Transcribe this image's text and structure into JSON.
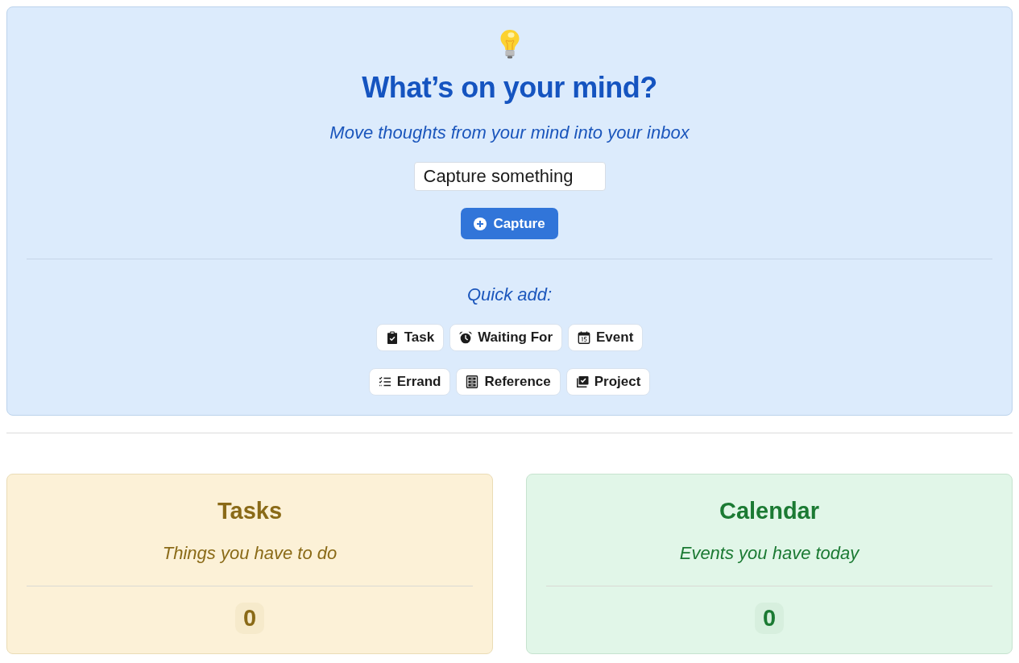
{
  "capture": {
    "title": "What’s on your mind?",
    "subtitle": "Move thoughts from your mind into your inbox",
    "input": {
      "value": "Capture something"
    },
    "button": "Capture",
    "quick_add": {
      "label": "Quick add:",
      "rows": [
        [
          {
            "kind": "task",
            "label": "Task"
          },
          {
            "kind": "waiting",
            "label": "Waiting For"
          },
          {
            "kind": "event",
            "label": "Event"
          }
        ],
        [
          {
            "kind": "errand",
            "label": "Errand"
          },
          {
            "kind": "reference",
            "label": "Reference"
          },
          {
            "kind": "project",
            "label": "Project"
          }
        ]
      ]
    }
  },
  "cards": [
    {
      "kind": "tasks",
      "title": "Tasks",
      "subtitle": "Things you have to do",
      "count": "0"
    },
    {
      "kind": "calendar",
      "title": "Calendar",
      "subtitle": "Events you have today",
      "count": "0"
    }
  ]
}
